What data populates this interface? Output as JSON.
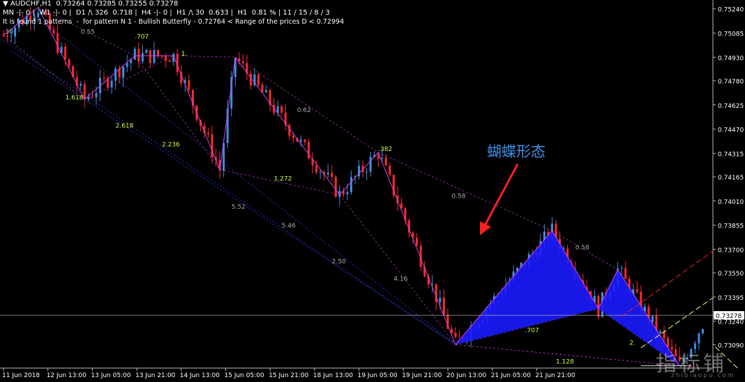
{
  "header": {
    "line1": "▼ AUDCHF,H1  0.73264 0.73285 0.73255 0.73278",
    "line2": "MN -|- 0 |  W1 -|- 0 |  D1 /\\ 326  0.718 |  H4 -|- 0 |  H1 /\\ 30  0.633 |  H1  0.81 % | 11 / 15 / 8 / 3",
    "line3": "It is found 1 patterns  -  for pattern N 1 - Bullish Butterfly - 0.72764 < Range of the prices D < 0.72994"
  },
  "annotation": "蝴蝶形态",
  "watermark": {
    "main": "指标铺",
    "sub": "zhibiaopu.com"
  },
  "colors": {
    "background": "#000000",
    "bull_candle": "#3d8ee6",
    "bear_candle": "#ff2a2a",
    "pattern_fill": "#1a1aff",
    "pattern_line": "#d040e0",
    "fib_text": "#c8ff40"
  },
  "chart_data": {
    "type": "candlestick",
    "symbol": "AUDCHF",
    "timeframe": "H1",
    "current_price": "0.73278",
    "ylim": [
      0.7294,
      0.7527
    ],
    "y_ticks": [
      "0.75240",
      "0.75085",
      "0.74930",
      "0.74780",
      "0.74625",
      "0.74470",
      "0.74315",
      "0.74165",
      "0.74010",
      "0.73855",
      "0.73700",
      "0.73550",
      "0.73395",
      "0.73240",
      "0.73090"
    ],
    "x_ticks": [
      "11 Jun 2018",
      "12 Jun 13:00",
      "13 Jun 05:00",
      "13 Jun 21:00",
      "14 Jun 13:00",
      "15 Jun 05:00",
      "15 Jun 21:00",
      "18 Jun 13:00",
      "19 Jun 05:00",
      "19 Jun 21:00",
      "20 Jun 13:00",
      "21 Jun 05:00",
      "21 Jun 21:00"
    ],
    "fib_labels": [
      {
        "text": ".50",
        "bar": 0,
        "price": 0.7508
      },
      {
        "text": "0.55",
        "bar": 20,
        "price": 0.7508
      },
      {
        "text": ".707",
        "bar": 34,
        "price": 0.7505
      },
      {
        "text": "1.",
        "bar": 46,
        "price": 0.7494
      },
      {
        "text": "1.618",
        "bar": 16,
        "price": 0.7466
      },
      {
        "text": "2.618",
        "bar": 29,
        "price": 0.7448
      },
      {
        "text": "2.236",
        "bar": 41,
        "price": 0.7436
      },
      {
        "text": "0.62",
        "bar": 76,
        "price": 0.7458
      },
      {
        "text": ".382",
        "bar": 97,
        "price": 0.7433
      },
      {
        "text": "1.272",
        "bar": 70,
        "price": 0.7414
      },
      {
        "text": "5.52",
        "bar": 59,
        "price": 0.7396
      },
      {
        "text": "5.46",
        "bar": 72,
        "price": 0.7384
      },
      {
        "text": "0.58",
        "bar": 116,
        "price": 0.7403
      },
      {
        "text": "2.50",
        "bar": 85,
        "price": 0.7361
      },
      {
        "text": "4.16",
        "bar": 101,
        "price": 0.735
      },
      {
        "text": "0.58",
        "bar": 148,
        "price": 0.737
      },
      {
        "text": ".707",
        "bar": 135,
        "price": 0.7317
      },
      {
        "text": "2.",
        "bar": 162,
        "price": 0.7309
      },
      {
        "text": "1.128",
        "bar": 143,
        "price": 0.7297
      }
    ],
    "pattern": {
      "name": "Bullish Butterfly",
      "X": {
        "bar": 117,
        "price": 0.7309
      },
      "A": {
        "bar": 142,
        "price": 0.7382
      },
      "B": {
        "bar": 154,
        "price": 0.7332
      },
      "C": {
        "bar": 159,
        "price": 0.7357
      },
      "D": {
        "bar": 175,
        "price": 0.72955
      }
    },
    "zigzag": [
      {
        "bar": 0,
        "price": 0.7507
      },
      {
        "bar": 9,
        "price": 0.7525
      },
      {
        "bar": 21,
        "price": 0.7466
      },
      {
        "bar": 34,
        "price": 0.7494
      },
      {
        "bar": 44,
        "price": 0.7494
      },
      {
        "bar": 56,
        "price": 0.7421
      },
      {
        "bar": 60,
        "price": 0.7493
      },
      {
        "bar": 87,
        "price": 0.7405
      },
      {
        "bar": 97,
        "price": 0.7432
      },
      {
        "bar": 117,
        "price": 0.7309
      },
      {
        "bar": 142,
        "price": 0.7382
      },
      {
        "bar": 154,
        "price": 0.7332
      },
      {
        "bar": 159,
        "price": 0.7357
      },
      {
        "bar": 175,
        "price": 0.72955
      }
    ]
  }
}
